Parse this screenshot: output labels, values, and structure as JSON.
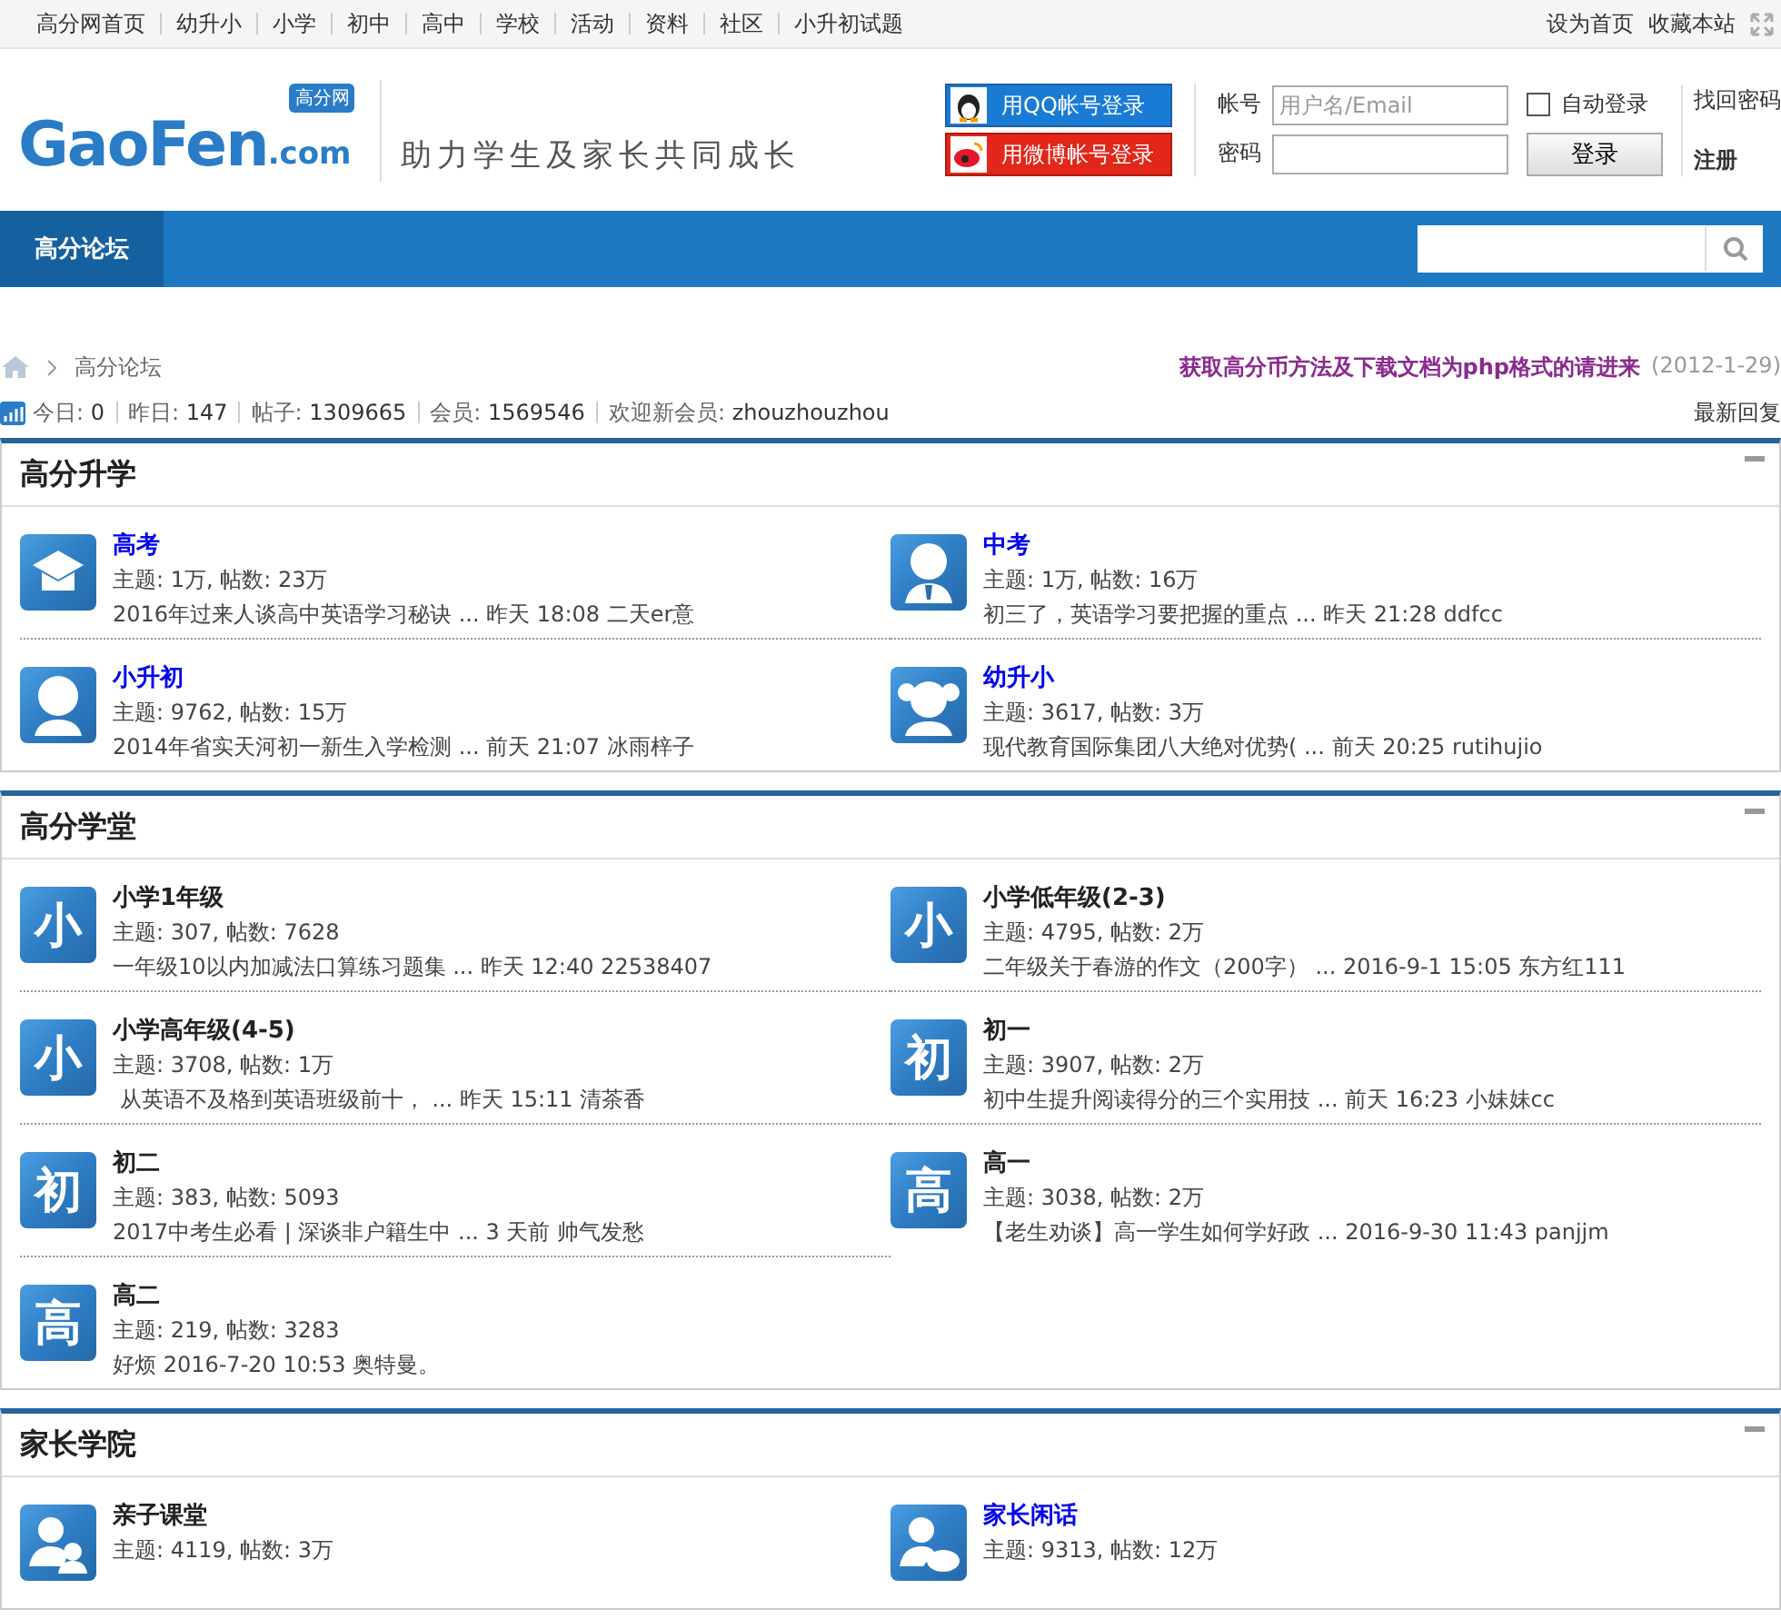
{
  "top_nav": {
    "links": [
      "高分网首页",
      "幼升小",
      "小学",
      "初中",
      "高中",
      "学校",
      "活动",
      "资料",
      "社区",
      "小升初试题"
    ],
    "right_links": [
      "设为首页",
      "收藏本站"
    ]
  },
  "header": {
    "logo": {
      "main": "GaoFen",
      "suffix": ".com",
      "badge": "高分网"
    },
    "slogan": "助力学生及家长共同成长",
    "social_login": [
      {
        "kind": "qq",
        "label": "用QQ帐号登录"
      },
      {
        "kind": "weibo",
        "label": "用微博帐号登录"
      }
    ],
    "login": {
      "username_label": "帐号",
      "username_placeholder": "用户名/Email",
      "password_label": "密码",
      "auto_login": {
        "label": "自动登录",
        "checked": false
      },
      "submit": "登录",
      "links": [
        "找回密码",
        "注册"
      ]
    }
  },
  "nav": {
    "tabs": [
      {
        "label": "高分论坛",
        "selected": true
      }
    ]
  },
  "breadcrumb": {
    "items": [
      "高分论坛"
    ]
  },
  "notice": {
    "title": "获取高分币方法及下载文档为php格式的请进来",
    "date": "(2012-1-29)"
  },
  "stats": {
    "items": [
      {
        "label": "今日:",
        "value": "0"
      },
      {
        "label": "昨日:",
        "value": "147"
      },
      {
        "label": "帖子:",
        "value": "1309665"
      },
      {
        "label": "会员:",
        "value": "1569546"
      },
      {
        "label": "欢迎新会员:",
        "value": "zhouzhouzhou"
      }
    ],
    "latest": "最新回复"
  },
  "sections": [
    {
      "title": "高分升学",
      "forums": [
        {
          "kind": "graduate",
          "name": "高考",
          "new": true,
          "stats": "主题: 1万, 帖数: 23万",
          "last_post": "2016年过来人谈高中英语学习秘诀 ... 昨天 18:08 二天er意"
        },
        {
          "kind": "tie",
          "name": "中考",
          "new": true,
          "stats": "主题: 1万, 帖数: 16万",
          "last_post": "初三了，英语学习要把握的重点 ... 昨天 21:28 ddfcc"
        },
        {
          "kind": "person",
          "name": "小升初",
          "new": true,
          "stats": "主题: 9762, 帖数: 15万",
          "last_post": "2014年省实天河初一新生入学检测 ... 前天 21:07 冰雨梓子"
        },
        {
          "kind": "girl",
          "name": "幼升小",
          "new": true,
          "stats": "主题: 3617, 帖数: 3万",
          "last_post": "现代教育国际集团八大绝对优势( ... 前天 20:25 rutihujio"
        }
      ]
    },
    {
      "title": "高分学堂",
      "forums": [
        {
          "kind": "glyph",
          "glyph": "小",
          "name": "小学1年级",
          "new": false,
          "stats": "主题: 307, 帖数: 7628",
          "last_post": "一年级10以内加减法口算练习题集 ... 昨天 12:40 22538407"
        },
        {
          "kind": "glyph",
          "glyph": "小",
          "name": "小学低年级(2-3)",
          "new": false,
          "stats": "主题: 4795, 帖数: 2万",
          "last_post": "二年级关于春游的作文（200字） ... 2016-9-1 15:05 东方红111"
        },
        {
          "kind": "glyph",
          "glyph": "小",
          "name": "小学高年级(4-5)",
          "new": false,
          "stats": "主题: 3708, 帖数: 1万",
          "last_post": " 从英语不及格到英语班级前十， ... 昨天 15:11 清茶香"
        },
        {
          "kind": "glyph",
          "glyph": "初",
          "name": "初一",
          "new": false,
          "stats": "主题: 3907, 帖数: 2万",
          "last_post": "初中生提升阅读得分的三个实用技 ... 前天 16:23 小妹妹cc"
        },
        {
          "kind": "glyph",
          "glyph": "初",
          "name": "初二",
          "new": false,
          "stats": "主题: 383, 帖数: 5093",
          "last_post": "2017中考生必看 | 深谈非户籍生中 ... 3 天前 帅气发愁"
        },
        {
          "kind": "glyph",
          "glyph": "高",
          "name": "高一",
          "new": false,
          "stats": "主题: 3038, 帖数: 2万",
          "last_post": "【老生劝谈】高一学生如何学好政 ... 2016-9-30 11:43 panjjm"
        },
        {
          "kind": "glyph",
          "glyph": "高",
          "name": "高二",
          "new": false,
          "stats": "主题: 219, 帖数: 3283",
          "last_post": "好烦 2016-7-20 10:53 奥特曼。"
        }
      ]
    },
    {
      "title": "家长学院",
      "forums": [
        {
          "kind": "parent",
          "name": "亲子课堂",
          "new": false,
          "stats": "主题: 4119, 帖数: 3万"
        },
        {
          "kind": "chat",
          "name": "家长闲话",
          "new": true,
          "stats": "主题: 9313, 帖数: 12万"
        }
      ]
    }
  ]
}
